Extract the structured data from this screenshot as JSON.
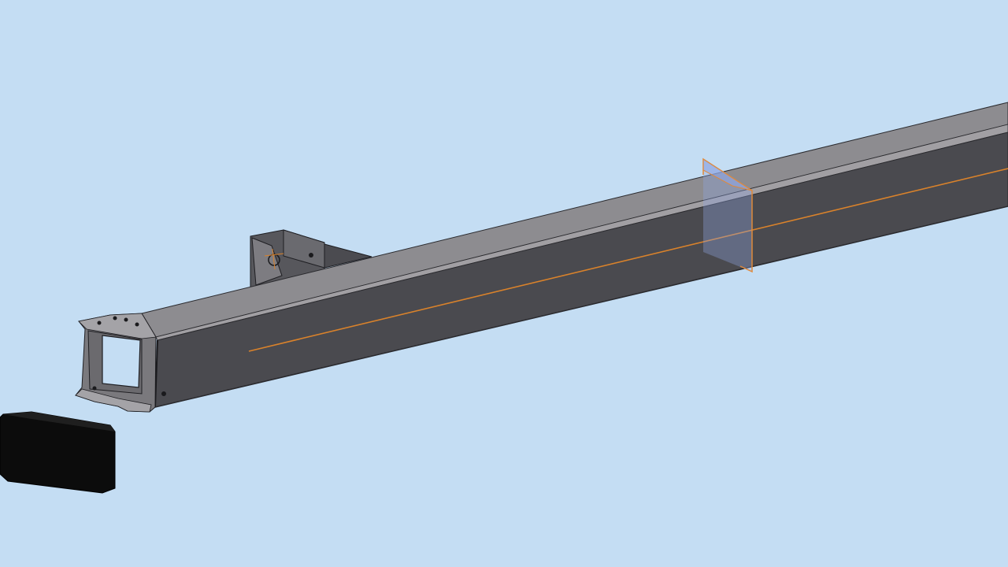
{
  "viewport": {
    "background_color": "#c4ddf3"
  },
  "model": {
    "beam_top_color": "#8d8c90",
    "beam_side_color": "#4a4a4f",
    "beam_edge_color": "#2a2a2e",
    "bracket_color": "#5c5c61",
    "end_plate_color": "#7a797d",
    "end_cap_color": "#0c0c0c",
    "axis_line_color": "#d9822b",
    "section_plane_fill": "#8fa7e3",
    "section_plane_edge": "#e0893a"
  }
}
